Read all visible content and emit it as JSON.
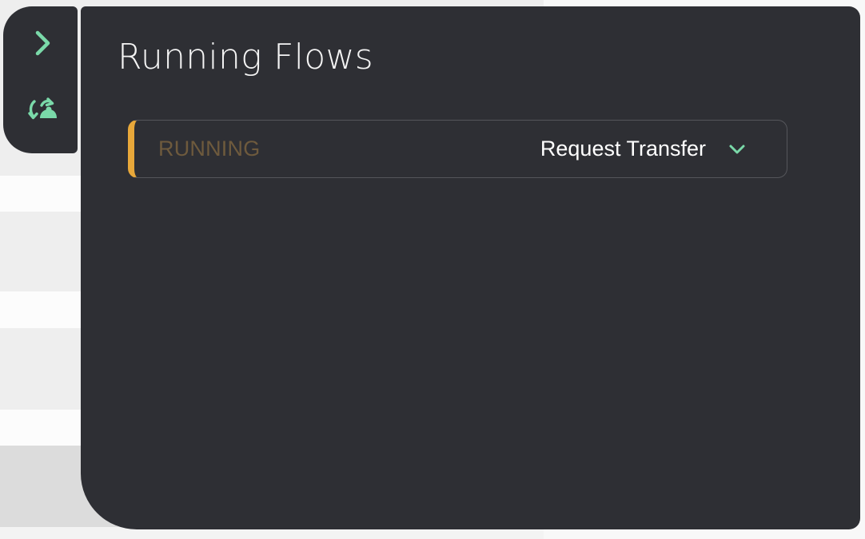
{
  "panel": {
    "title": "Running Flows"
  },
  "sidebar": {
    "expand_icon": "chevron-right-icon",
    "flows_icon": "flow-cycle-icon",
    "accent_color": "#7ad9a9"
  },
  "flows": [
    {
      "status": "RUNNING",
      "name": "Request Transfer",
      "status_color": "#e8a83a",
      "toggle_icon": "chevron-down-icon"
    }
  ]
}
